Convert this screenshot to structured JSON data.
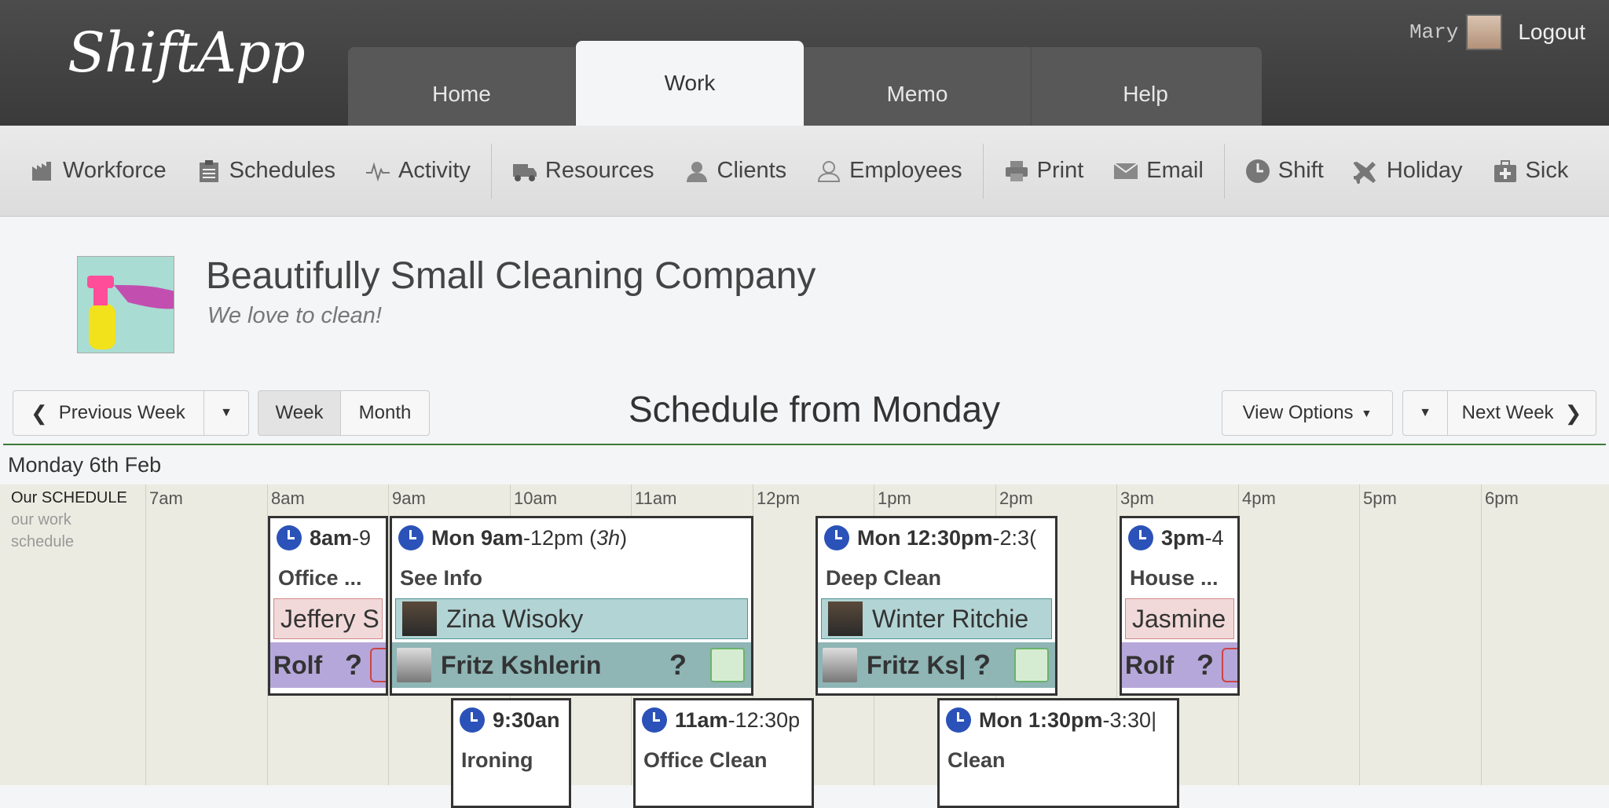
{
  "app": {
    "name": "ShiftApp"
  },
  "nav_tabs": [
    {
      "label": "Home"
    },
    {
      "label": "Work"
    },
    {
      "label": "Memo"
    },
    {
      "label": "Help"
    }
  ],
  "active_tab": "Work",
  "user": {
    "name": "Mary",
    "logout_label": "Logout"
  },
  "toolbar": {
    "items": [
      {
        "label": "Workforce",
        "icon": "factory-icon"
      },
      {
        "label": "Schedules",
        "icon": "clipboard-icon"
      },
      {
        "label": "Activity",
        "icon": "pulse-icon"
      },
      {
        "label": "Resources",
        "icon": "truck-icon"
      },
      {
        "label": "Clients",
        "icon": "clients-icon"
      },
      {
        "label": "Employees",
        "icon": "person-icon"
      },
      {
        "label": "Print",
        "icon": "printer-icon"
      },
      {
        "label": "Email",
        "icon": "envelope-icon"
      },
      {
        "label": "Shift",
        "icon": "clock-icon"
      },
      {
        "label": "Holiday",
        "icon": "airplane-icon"
      },
      {
        "label": "Sick",
        "icon": "medkit-icon"
      }
    ]
  },
  "company": {
    "name": "Beautifully Small Cleaning Company",
    "tagline": "We love to clean!"
  },
  "controls": {
    "prev_week": "Previous Week",
    "week": "Week",
    "month": "Month",
    "title": "Schedule from Monday",
    "view_options": "View Options",
    "next_week": "Next Week"
  },
  "day_label": "Monday 6th Feb",
  "schedule": {
    "name": "Our SCHEDULE",
    "description": "our work schedule"
  },
  "hours": [
    "7am",
    "8am",
    "9am",
    "10am",
    "11am",
    "12pm",
    "1pm",
    "2pm",
    "3pm",
    "4pm",
    "5pm",
    "6pm"
  ],
  "shifts": [
    {
      "time_bold": "8am",
      "time_rest": "-9",
      "title": "Office ...",
      "client": "Jeffery S",
      "employee": "Rolf",
      "q": "?"
    },
    {
      "time_bold": "Mon 9am",
      "time_rest": "-12pm (",
      "duration": "3h",
      "time_end": ")",
      "title": "See Info",
      "client": "Zina Wisoky",
      "employee": "Fritz Kshlerin",
      "q": "?"
    },
    {
      "time_bold": "Mon 12:30pm",
      "time_rest": "-2:3(",
      "title": "Deep Clean",
      "client": "Winter Ritchie",
      "employee": "Fritz Ks|",
      "q": "?"
    },
    {
      "time_bold": "3pm",
      "time_rest": "-4",
      "title": "House ...",
      "client": "Jasmine",
      "employee": "Rolf",
      "q": "?"
    },
    {
      "time_bold": "9:30an",
      "time_rest": "",
      "title": "Ironing"
    },
    {
      "time_bold": "11am",
      "time_rest": "-12:30p",
      "title": "Office Clean"
    },
    {
      "time_bold": "Mon 1:30pm",
      "time_rest": "-3:30|",
      "title": "Clean"
    }
  ]
}
